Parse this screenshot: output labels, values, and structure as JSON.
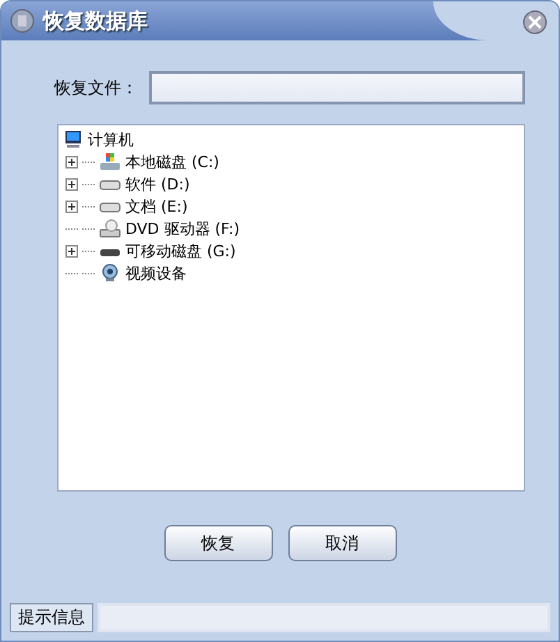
{
  "window": {
    "title": "恢复数据库"
  },
  "file_field": {
    "label": "恢复文件："
  },
  "tree": {
    "label": "计算机",
    "children": [
      {
        "label": "本地磁盘 (C:)",
        "kind": "system-drive",
        "expandable": true
      },
      {
        "label": "软件 (D:)",
        "kind": "drive",
        "expandable": true
      },
      {
        "label": "文档 (E:)",
        "kind": "drive",
        "expandable": true
      },
      {
        "label": "DVD 驱动器 (F:)",
        "kind": "dvd",
        "expandable": false
      },
      {
        "label": "可移动磁盘 (G:)",
        "kind": "removable",
        "expandable": true
      },
      {
        "label": "视频设备",
        "kind": "camera",
        "expandable": false
      }
    ]
  },
  "buttons": [
    "恢复",
    "取消"
  ],
  "status_bar": {
    "label": "提示信息"
  }
}
